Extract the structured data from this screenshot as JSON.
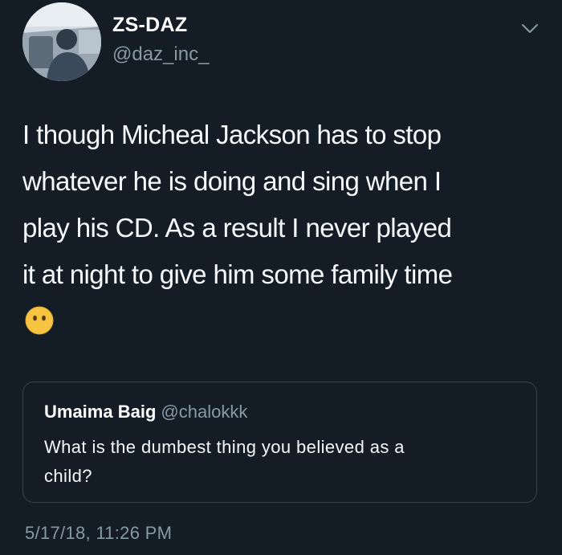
{
  "author": {
    "display_name": "ZS-DAZ",
    "handle": "@daz_inc_"
  },
  "tweet": {
    "text_lines": [
      "I though Micheal Jackson has to stop",
      "whatever he is doing and sing when I",
      "play his CD. As a result I never played",
      "it at night to give him some family time"
    ],
    "emoji": "face-without-mouth-emoji",
    "timestamp": "5/17/18, 11:26 PM"
  },
  "quoted_tweet": {
    "display_name": "Umaima Baig",
    "handle": "@chalokkk",
    "text_lines": [
      "What is the dumbest thing you believed as a",
      "child?"
    ]
  },
  "icons": {
    "menu": "chevron-down-icon"
  },
  "colors": {
    "background": "#141d26",
    "secondary_text": "#8899a6",
    "border": "#38444d",
    "emoji": "#f7c542"
  }
}
